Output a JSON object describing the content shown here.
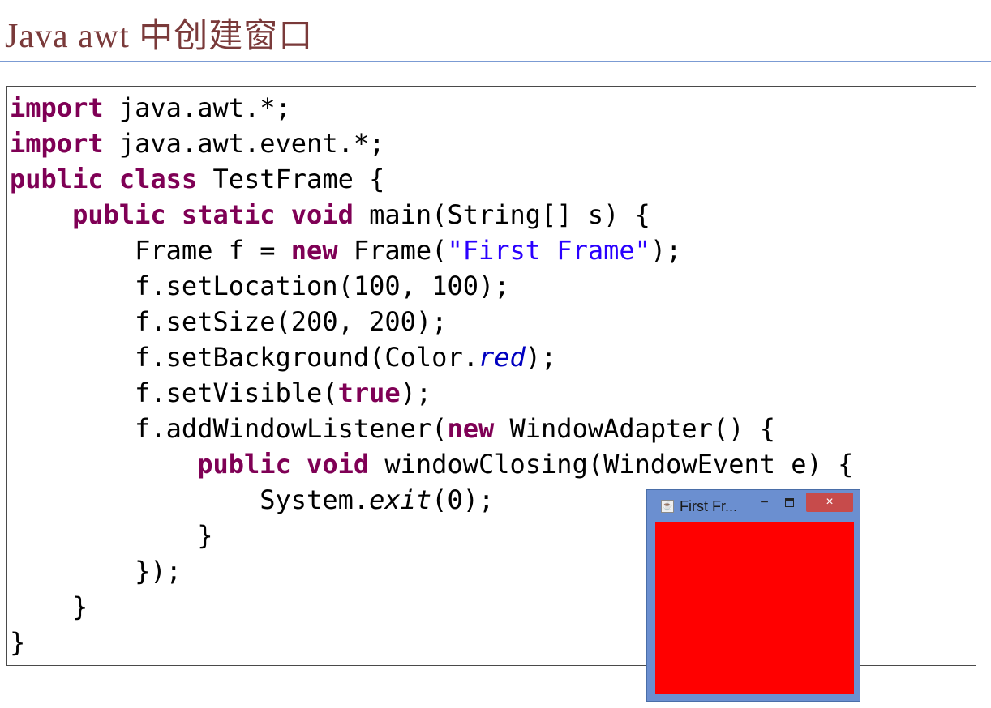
{
  "slide": {
    "title": "Java awt 中创建窗口"
  },
  "code": {
    "l1_kw": "import",
    "l1_rest": " java.awt.*;",
    "l2_kw": "import",
    "l2_rest": " java.awt.event.*;",
    "l3_kw1": "public",
    "l3_sp": " ",
    "l3_kw2": "class",
    "l3_rest": " TestFrame {",
    "l4_indent": "    ",
    "l4_kw1": "public",
    "l4_kw2": "static",
    "l4_kw3": "void",
    "l4_rest": " main(String[] s) {",
    "l5_pre": "        Frame f = ",
    "l5_kw": "new",
    "l5_mid": " Frame(",
    "l5_str": "\"First Frame\"",
    "l5_end": ");",
    "l6": "        f.setLocation(100, 100);",
    "l7": "        f.setSize(200, 200);",
    "l8_pre": "        f.setBackground(Color.",
    "l8_field": "red",
    "l8_end": ");",
    "l9_pre": "        f.setVisible(",
    "l9_kw": "true",
    "l9_end": ");",
    "l10_pre": "        f.addWindowListener(",
    "l10_kw": "new",
    "l10_end": " WindowAdapter() {",
    "l11_indent": "            ",
    "l11_kw1": "public",
    "l11_kw2": "void",
    "l11_rest": " windowClosing(WindowEvent e) {",
    "l12_pre": "                System.",
    "l12_ital": "exit",
    "l12_end": "(0);",
    "l13": "            }",
    "l14": "        });",
    "l15": "    }",
    "l16": "}"
  },
  "awt_window": {
    "title": "First Fr...",
    "minimize_label": "−",
    "close_label": "×",
    "icon": "java-cup-icon",
    "background_color": "#ff0000",
    "frame_color": "#6b8fd0"
  }
}
